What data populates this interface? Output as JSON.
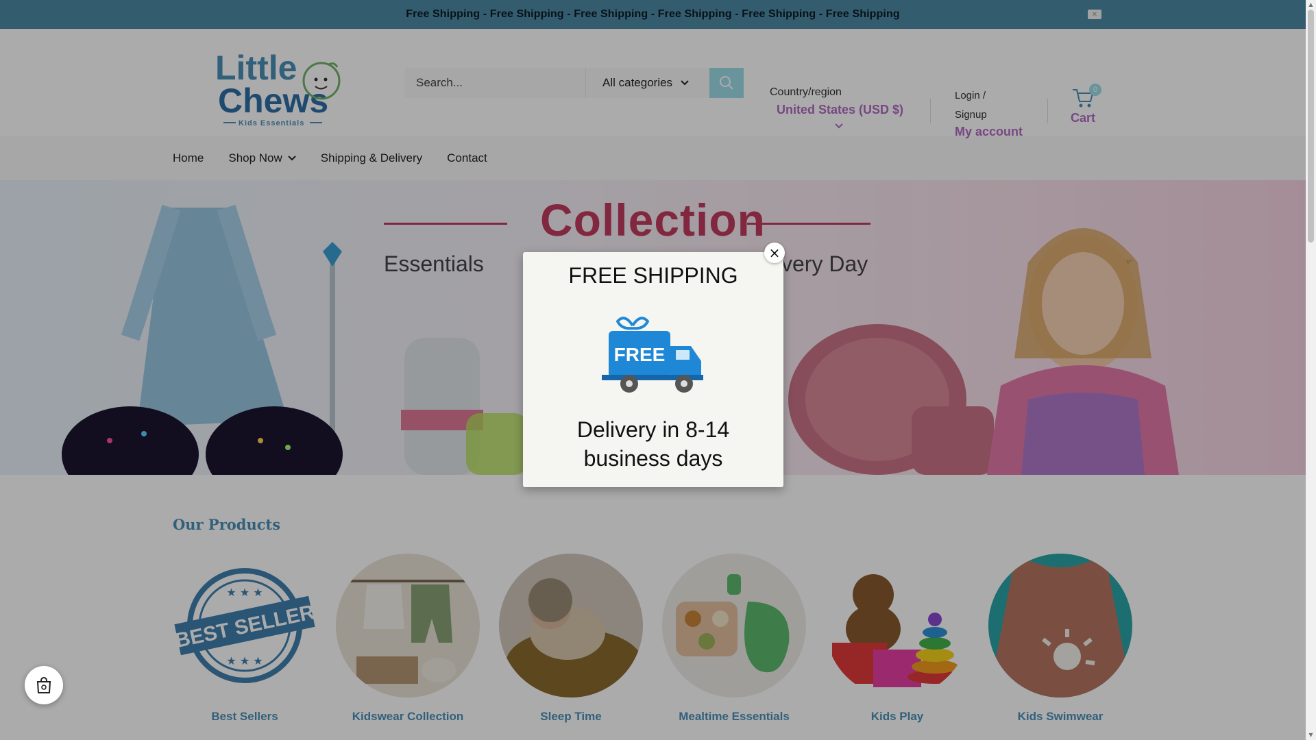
{
  "announcement": {
    "text": "Free Shipping - Free Shipping - Free Shipping - Free Shipping - Free Shipping - Free Shipping"
  },
  "header": {
    "logo_text_line1": "Little",
    "logo_text_line2": "Chews",
    "logo_tagline": "Kids Essentials",
    "search_placeholder": "Search...",
    "category_select": "All categories",
    "country_label": "Country/region",
    "country_value": "United States (USD $)",
    "login_line1": "Login /",
    "login_line2": "Signup",
    "my_account": "My account",
    "cart_label": "Cart",
    "cart_count": "0"
  },
  "nav": {
    "items": [
      "Home",
      "Shop Now",
      "Shipping & Delivery",
      "Contact"
    ]
  },
  "hero": {
    "title": "Collection",
    "subtitle_left": "Essentials for",
    "subtitle_right": "very Day"
  },
  "products": {
    "section_title": "Our Products",
    "categories": [
      "Best Sellers",
      "Kidswear Collection",
      "Sleep Time",
      "Mealtime Essentials",
      "Kids Play",
      "Kids Swimwear"
    ],
    "badge_text": "BEST SELLER"
  },
  "modal": {
    "title": "FREE SHIPPING",
    "truck_text": "FREE",
    "body": "Delivery in 8-14 business days",
    "close_symbol": "×"
  },
  "colors": {
    "announce_bg": "#4e8aa6",
    "accent_purple": "#b26ac4",
    "accent_blue": "#4b8fb8",
    "search_btn": "#9ddde8"
  }
}
